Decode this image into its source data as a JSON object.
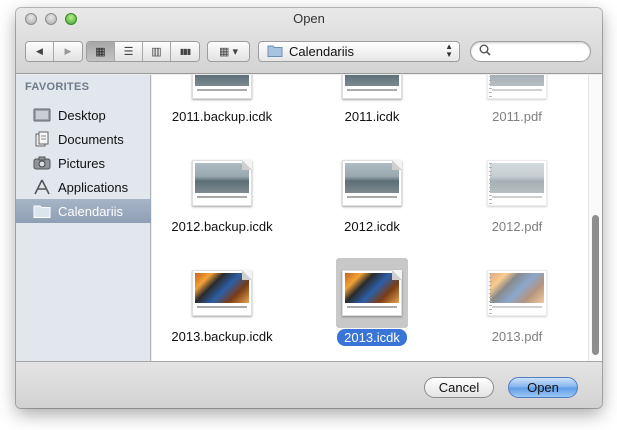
{
  "window": {
    "title": "Open"
  },
  "toolbar": {
    "back_icon": "◀",
    "forward_icon": "▶",
    "view_modes": [
      {
        "name": "icon-view",
        "glyph": "▦",
        "active": true
      },
      {
        "name": "list-view",
        "glyph": "☰",
        "active": false
      },
      {
        "name": "column-view",
        "glyph": "▥",
        "active": false
      },
      {
        "name": "coverflow-view",
        "glyph": "▮▮▮",
        "active": false
      }
    ],
    "arrange_glyph": "▦ ▾",
    "location": "Calendariis",
    "search_placeholder": ""
  },
  "sidebar": {
    "heading": "FAVORITES",
    "items": [
      {
        "label": "Desktop",
        "icon": "desktop-icon",
        "selected": false
      },
      {
        "label": "Documents",
        "icon": "documents-icon",
        "selected": false
      },
      {
        "label": "Pictures",
        "icon": "camera-icon",
        "selected": false
      },
      {
        "label": "Applications",
        "icon": "applications-icon",
        "selected": false
      },
      {
        "label": "Calendariis",
        "icon": "folder-icon",
        "selected": true
      }
    ]
  },
  "files": [
    {
      "name": "2011.backup.icdk",
      "kind": "icdk",
      "photo": "gray"
    },
    {
      "name": "2011.icdk",
      "kind": "icdk",
      "photo": "gray"
    },
    {
      "name": "2011.pdf",
      "kind": "pdf",
      "photo": "gray"
    },
    {
      "name": "2012.backup.icdk",
      "kind": "icdk",
      "photo": "gray"
    },
    {
      "name": "2012.icdk",
      "kind": "icdk",
      "photo": "gray"
    },
    {
      "name": "2012.pdf",
      "kind": "pdf",
      "photo": "gray"
    },
    {
      "name": "2013.backup.icdk",
      "kind": "icdk",
      "photo": "color"
    },
    {
      "name": "2013.icdk",
      "kind": "icdk",
      "photo": "color",
      "selected": true
    },
    {
      "name": "2013.pdf",
      "kind": "pdf",
      "photo": "color"
    }
  ],
  "buttons": {
    "cancel": "Cancel",
    "open": "Open"
  },
  "colors": {
    "selection": "#3875d7",
    "sidebar_bg": "#e2e7ed",
    "default_button": "#5d9be8"
  }
}
